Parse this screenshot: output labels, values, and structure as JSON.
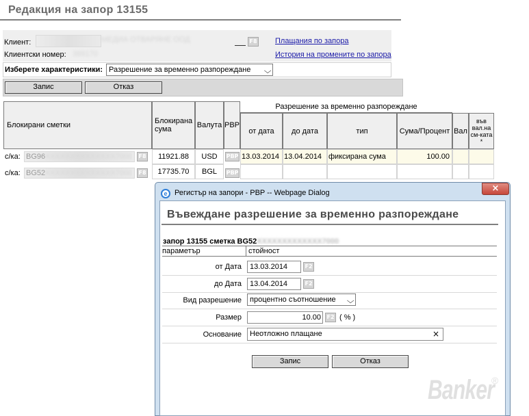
{
  "page": {
    "title": "Редакция на запор 13155"
  },
  "client": {
    "client_label": "Клиент:",
    "client_value": "МЕДИА ОТВАРЯНЕ ООД",
    "client_button": "F8",
    "number_label": "Клиентски номер:",
    "number_value": "389170",
    "link_payments": "Плащания по запора",
    "link_history": "История на промените по запора"
  },
  "characteristics": {
    "label": "Изберете характеристики:",
    "selected": "Разрешение за временно разпореждане"
  },
  "toolbar": {
    "save_label": "Запис",
    "cancel_label": "Отказ"
  },
  "grid": {
    "headers": {
      "accounts": "Блокирани сметки",
      "blocked_sum": "Блокирана сума",
      "currency": "Валута",
      "pbp": "PBP",
      "group": "Разрешение за временно разпореждане",
      "from_date": "от дата",
      "to_date": "до дата",
      "type": "тип",
      "sum_percent": "Сума/Процент",
      "val": "Вал",
      "in_currency": "във вал.на см-ката *"
    },
    "rows": [
      {
        "prefix": "с/ка:",
        "account": "BG96",
        "account_tail": "XXXXXXXXXXXXXX7000",
        "button": "F8",
        "blocked_sum": "11921.88",
        "currency": "USD",
        "pbp": "PBP",
        "from_date": "13.03.2014",
        "to_date": "13.04.2014",
        "type": "фиксирана сума",
        "sum_percent": "100.00"
      },
      {
        "prefix": "с/ка:",
        "account": "BG52",
        "account_tail": "XXXXXXXXXXXXXX7000",
        "button": "F8",
        "blocked_sum": "17735.70",
        "currency": "BGL",
        "pbp": "PBP"
      }
    ]
  },
  "dialog": {
    "window_title": "Регистър на запори - PBP -- Webpage Dialog",
    "close_icon": "×",
    "heading": "Въвеждане разрешение за временно разпореждане",
    "subtitle": "запор 13155  сметка BG52",
    "subtitle_tail": "XXXXXXXXXXXXX7000",
    "col_param": "параметър",
    "col_value": "стойност",
    "from_label": "от Дата",
    "from_value": "13.03.2014",
    "to_label": "до Дата",
    "to_value": "13.04.2014",
    "date_button": "F2",
    "kind_label": "Вид разрешение",
    "kind_value": "процентно съотношение",
    "size_label": "Размер",
    "size_value": "10.00",
    "size_unit": "( % )",
    "reason_label": "Основание",
    "reason_value": "Неотложно плащане",
    "clear_icon": "×",
    "save_label": "Запис",
    "cancel_label": "Отказ",
    "watermark": "Banker",
    "watermark_reg": "®"
  },
  "colors": {
    "link": "#1a1aa8",
    "dialog_frame": "#cfe0f0",
    "close_button": "#c7473a",
    "title_gray": "#6a6a6a"
  }
}
